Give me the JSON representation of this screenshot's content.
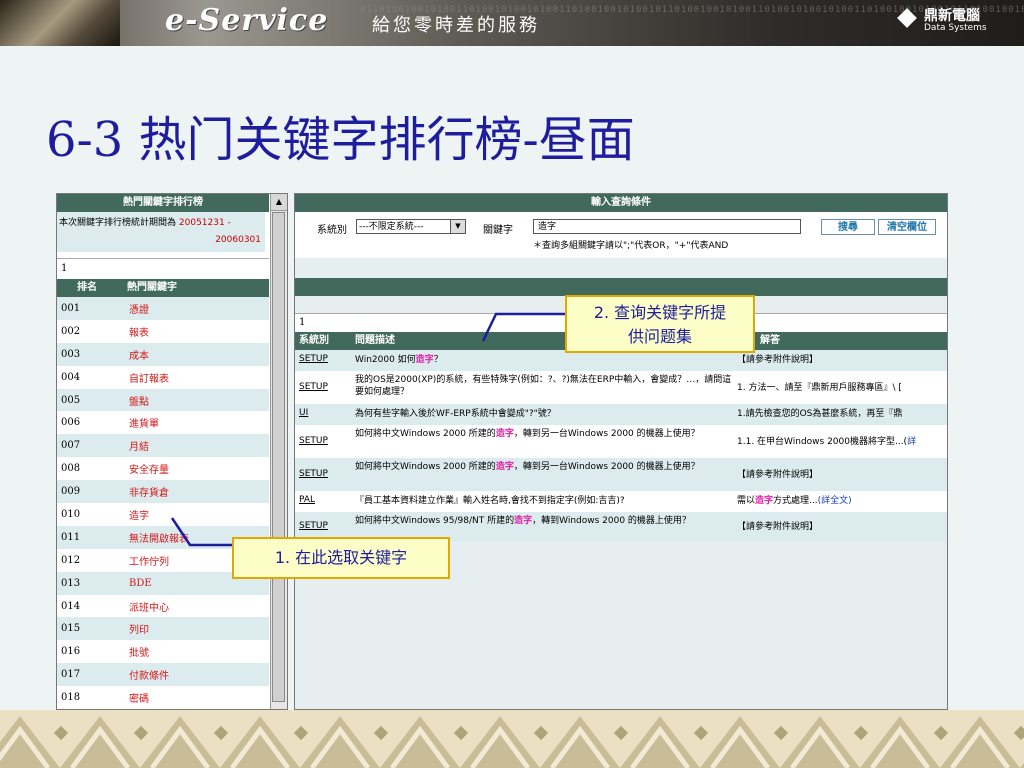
{
  "banner": {
    "logo": "e-Service",
    "tagline": "給您零時差的服務",
    "brand_name": "鼎新電腦",
    "brand_sub": "Data Systems",
    "binary_text": "0110100100101001101001010010100110100100101001011010010010100110100101001010011010010010100101101001001010011010010100101001101001001010010110100100101001101001010010100110100100101001011010010010100110100101001010011010010010100101101001001010011010010100101001"
  },
  "slide_title": "6-3 热门关键字排行榜-昼面",
  "left_panel": {
    "header": "熱門關鍵字排行榜",
    "stat_text": "本次關鍵字排行榜統計期間為",
    "stat_date_start": "20051231 -",
    "stat_date_end": "20060301",
    "count": "1",
    "col_rank": "排名",
    "col_keyword": "熱門關鍵字",
    "rows": [
      {
        "rank": "001",
        "keyword": "憑證"
      },
      {
        "rank": "002",
        "keyword": "報表"
      },
      {
        "rank": "003",
        "keyword": "成本"
      },
      {
        "rank": "004",
        "keyword": "自訂報表"
      },
      {
        "rank": "005",
        "keyword": "盤點"
      },
      {
        "rank": "006",
        "keyword": "進貨單"
      },
      {
        "rank": "007",
        "keyword": "月結"
      },
      {
        "rank": "008",
        "keyword": "安全存量"
      },
      {
        "rank": "009",
        "keyword": "非存貨倉"
      },
      {
        "rank": "010",
        "keyword": "造字"
      },
      {
        "rank": "011",
        "keyword": "無法開啟報表"
      },
      {
        "rank": "012",
        "keyword": "工作佇列"
      },
      {
        "rank": "013",
        "keyword": "BDE"
      },
      {
        "rank": "014",
        "keyword": "派班中心"
      },
      {
        "rank": "015",
        "keyword": "列印"
      },
      {
        "rank": "016",
        "keyword": "批號"
      },
      {
        "rank": "017",
        "keyword": "付款條件"
      },
      {
        "rank": "018",
        "keyword": "密碼"
      }
    ]
  },
  "right_panel": {
    "header": "輸入查詢條件",
    "system_label": "系統別",
    "system_value": "---不限定系統---",
    "keyword_label": "關鍵字",
    "keyword_value": "造字",
    "hint": "＊查詢多組關鍵字請以\";\"代表OR，\"+\"代表AND",
    "search_button": "搜尋",
    "clear_button": "清空欄位",
    "count": "1",
    "col_system": "系統別",
    "col_desc": "問題描述",
    "col_answer": "解答",
    "rows": [
      {
        "sys": "SETUP",
        "desc_pre": "Win2000 如何",
        "desc_hl": "造字",
        "desc_post": "？",
        "ans_pre": "【請參考附件說明】",
        "ans_link": ""
      },
      {
        "sys": "SETUP",
        "desc_pre": "我的OS是2000(XP)的系統，有些特殊字(例如：?、?)無法在ERP中輸入，會變成？…，請問這要如何處理？",
        "desc_hl": "",
        "desc_post": "",
        "ans_pre": "1. 方法一、請至『鼎新用戶服務專區』\\ [",
        "ans_link": ""
      },
      {
        "sys": "UI",
        "desc_pre": "為何有些字輸入後於WF-ERP系統中會變成\"?\"號？",
        "desc_hl": "",
        "desc_post": "",
        "ans_pre": "1.請先檢查您的OS為甚麼系統，再至『鼎",
        "ans_link": ""
      },
      {
        "sys": "SETUP",
        "desc_pre": "如何將中文Windows 2000 所建的",
        "desc_hl": "造字",
        "desc_post": "，轉到另一台Windows 2000 的機器上使用？",
        "ans_pre": "1.1. 在甲台Windows 2000機器將字型...(",
        "ans_link": "詳"
      },
      {
        "sys": "SETUP",
        "desc_pre": "如何將中文Windows 2000 所建的",
        "desc_hl": "造字",
        "desc_post": "，轉到另一台Windows 2000 的機器上使用？",
        "ans_pre": "【請參考附件說明】",
        "ans_link": ""
      },
      {
        "sys": "PAL",
        "desc_pre": "『員工基本資料建立作業』輸入姓名時,會找不到指定字(例如:吉吉)?",
        "desc_hl": "",
        "desc_post": "",
        "ans_pre": "需以",
        "ans_hl": "造字",
        "ans_post": "方式處理...",
        "ans_link": "(詳全文)"
      },
      {
        "sys": "SETUP",
        "desc_pre": "如何將中文Windows 95/98/NT 所建的",
        "desc_hl": "造字",
        "desc_post": "，轉到Windows 2000 的機器上使用？",
        "ans_pre": "【請參考附件說明】",
        "ans_link": ""
      }
    ]
  },
  "callouts": {
    "step1": "1. 在此选取关键字",
    "step2_line1": "2. 查询关键字所提",
    "step2_line2": "供问题集"
  },
  "colors": {
    "header_green": "#416a5c",
    "keyword_red": "#d41818",
    "title_blue": "#1d1d9e",
    "callout_border": "#e0a800",
    "highlight_magenta": "#e01ea8"
  }
}
